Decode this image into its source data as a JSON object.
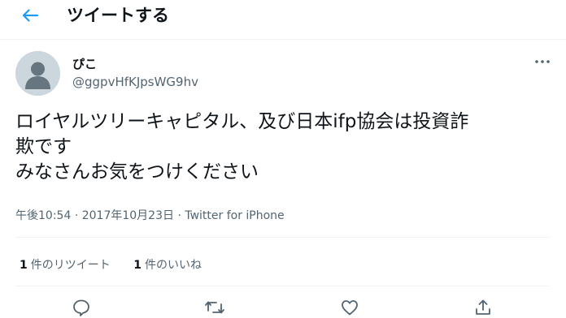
{
  "header": {
    "title": "ツイートする",
    "back_icon": "back-arrow-icon"
  },
  "author": {
    "name": "ぴこ",
    "handle": "@ggpvHfKJpsWG9hv"
  },
  "tweet": {
    "lines": [
      "ロイヤルツリーキャピタル、及び日本ifp協会は投資詐",
      "欺です",
      "みなさんお気をつけください"
    ]
  },
  "meta": {
    "time": "午後10:54",
    "separator": "·",
    "date": "2017年10月23日",
    "source": "Twitter for iPhone"
  },
  "stats": {
    "retweets": {
      "count": "1",
      "label": "件のリツイート"
    },
    "likes": {
      "count": "1",
      "label": "件のいいね"
    }
  },
  "actions": [
    "reply-icon",
    "retweet-icon",
    "like-icon",
    "share-icon"
  ],
  "colors": {
    "accent": "#1d9bf0",
    "text": "#0f1419",
    "secondary": "#536471"
  }
}
